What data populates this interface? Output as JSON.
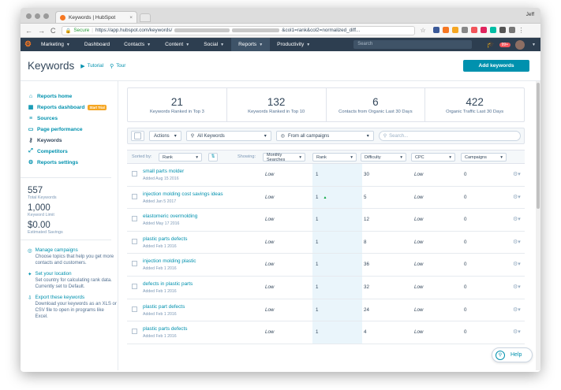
{
  "browser": {
    "tab_title": "Keywords | HubSpot",
    "tab_close": "×",
    "profile_name": "Jeff",
    "secure_label": "Secure",
    "url_start": "https://app.hubspot.com/keywords/",
    "url_end": "&col1=rank&col2=normalized_diff...",
    "back": "←",
    "forward": "→",
    "reload": "C"
  },
  "nav": {
    "logo": "⚙",
    "items": [
      {
        "label": "Marketing"
      },
      {
        "label": "Dashboard"
      },
      {
        "label": "Contacts"
      },
      {
        "label": "Content"
      },
      {
        "label": "Social"
      },
      {
        "label": "Reports"
      },
      {
        "label": "Productivity"
      }
    ],
    "search_placeholder": "Search",
    "notification_count": "99+"
  },
  "header": {
    "title": "Keywords",
    "tutorial": "Tutorial",
    "tour": "Tour",
    "add_button": "Add keywords"
  },
  "sidebar": {
    "items": [
      {
        "label": "Reports home",
        "icon": "home-icon"
      },
      {
        "label": "Reports dashboard",
        "icon": "dashboard-icon",
        "badge": "Start Trial"
      },
      {
        "label": "Sources",
        "icon": "sources-icon"
      },
      {
        "label": "Page performance",
        "icon": "page-icon"
      },
      {
        "label": "Keywords",
        "icon": "key-icon"
      },
      {
        "label": "Competitors",
        "icon": "competitors-icon"
      },
      {
        "label": "Reports settings",
        "icon": "gear-icon"
      }
    ],
    "stats": [
      {
        "value": "557",
        "label": "Total Keywords"
      },
      {
        "value": "1,000",
        "label": "Keyword Limit"
      },
      {
        "value": "$0.00",
        "label": "Estimated Savings"
      }
    ],
    "help": [
      {
        "title": "Manage campaigns",
        "desc": "Choose topics that help you get more contacts and customers."
      },
      {
        "title": "Set your location",
        "desc": "Set country for calculating rank data. Currently set to Default."
      },
      {
        "title": "Export these keywords",
        "desc": "Download your keywords as an XLS or CSV file to open in programs like Excel."
      }
    ]
  },
  "stats": [
    {
      "value": "21",
      "label": "Keywords Ranked in Top 3"
    },
    {
      "value": "132",
      "label": "Keywords Ranked in Top 10"
    },
    {
      "value": "6",
      "label": "Contacts from Organic Last 30 Days"
    },
    {
      "value": "422",
      "label": "Organic Traffic Last 30 Days"
    }
  ],
  "filters": {
    "actions": "Actions",
    "keywords": "All Keywords",
    "campaigns": "From all campaigns",
    "search_placeholder": "Search..."
  },
  "sort": {
    "sorted_by": "Sorted by:",
    "sort_value": "Rank",
    "showing": "Showing:",
    "columns": [
      "Monthly Searches",
      "Rank",
      "Difficulty",
      "CPC",
      "Campaigns"
    ]
  },
  "rows": [
    {
      "keyword": "small parts molder",
      "added": "Added Aug 15 2016",
      "searches": "Low",
      "rank": "1",
      "difficulty": "30",
      "cpc": "Low",
      "campaigns": "0",
      "trend": ""
    },
    {
      "keyword": "injection molding cost savings ideas",
      "added": "Added Jan 5 2017",
      "searches": "Low",
      "rank": "1",
      "difficulty": "5",
      "cpc": "Low",
      "campaigns": "0",
      "trend": "▲"
    },
    {
      "keyword": "elastomeric overmolding",
      "added": "Added May 17 2016",
      "searches": "Low",
      "rank": "1",
      "difficulty": "12",
      "cpc": "Low",
      "campaigns": "0",
      "trend": ""
    },
    {
      "keyword": "plastic parts defects",
      "added": "Added Feb 1 2016",
      "searches": "Low",
      "rank": "1",
      "difficulty": "8",
      "cpc": "Low",
      "campaigns": "0",
      "trend": ""
    },
    {
      "keyword": "injection molding plastic",
      "added": "Added Feb 1 2016",
      "searches": "Low",
      "rank": "1",
      "difficulty": "36",
      "cpc": "Low",
      "campaigns": "0",
      "trend": ""
    },
    {
      "keyword": "defects in plastic parts",
      "added": "Added Feb 1 2016",
      "searches": "Low",
      "rank": "1",
      "difficulty": "32",
      "cpc": "Low",
      "campaigns": "0",
      "trend": ""
    },
    {
      "keyword": "plastic part defects",
      "added": "Added Feb 1 2016",
      "searches": "Low",
      "rank": "1",
      "difficulty": "24",
      "cpc": "Low",
      "campaigns": "0",
      "trend": ""
    },
    {
      "keyword": "plastic parts defects",
      "added": "Added Feb 1 2016",
      "searches": "Low",
      "rank": "1",
      "difficulty": "4",
      "cpc": "Low",
      "campaigns": "0",
      "trend": ""
    }
  ],
  "help_button": "Help",
  "colors": {
    "accent": "#0091ae",
    "nav_bg": "#2d3e50",
    "brand": "#f57722"
  }
}
